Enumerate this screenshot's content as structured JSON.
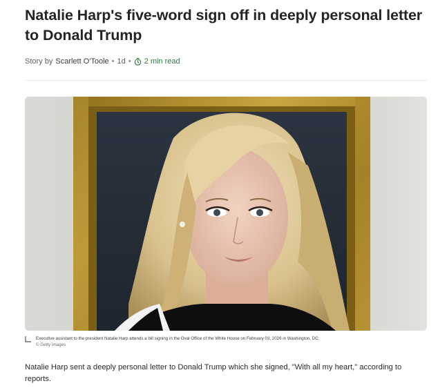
{
  "article": {
    "headline": "Natalie Harp's five-word sign off in deeply personal letter to Donald Trump",
    "byline_prefix": "Story by",
    "author": "Scarlett O'Toole",
    "bullet": "•",
    "age": "1d",
    "read_time": "2 min read",
    "image": {
      "caption": "Executive assistant to the president Natalie Harp attends a bill signing in the Oval Office of the White House on February 03, 2026 in Washington, DC.",
      "credit": "© Getty Images"
    },
    "lede": "Natalie Harp sent a deeply personal letter to Donald Trump which she signed, \"With all my heart,\" according to reports."
  },
  "colors": {
    "headline": "#242424",
    "read_time": "#2f7a3c",
    "frame_gold": "#b8962e"
  },
  "icons": {
    "read_time": "clock-icon",
    "caption": "caption-corner-icon"
  }
}
